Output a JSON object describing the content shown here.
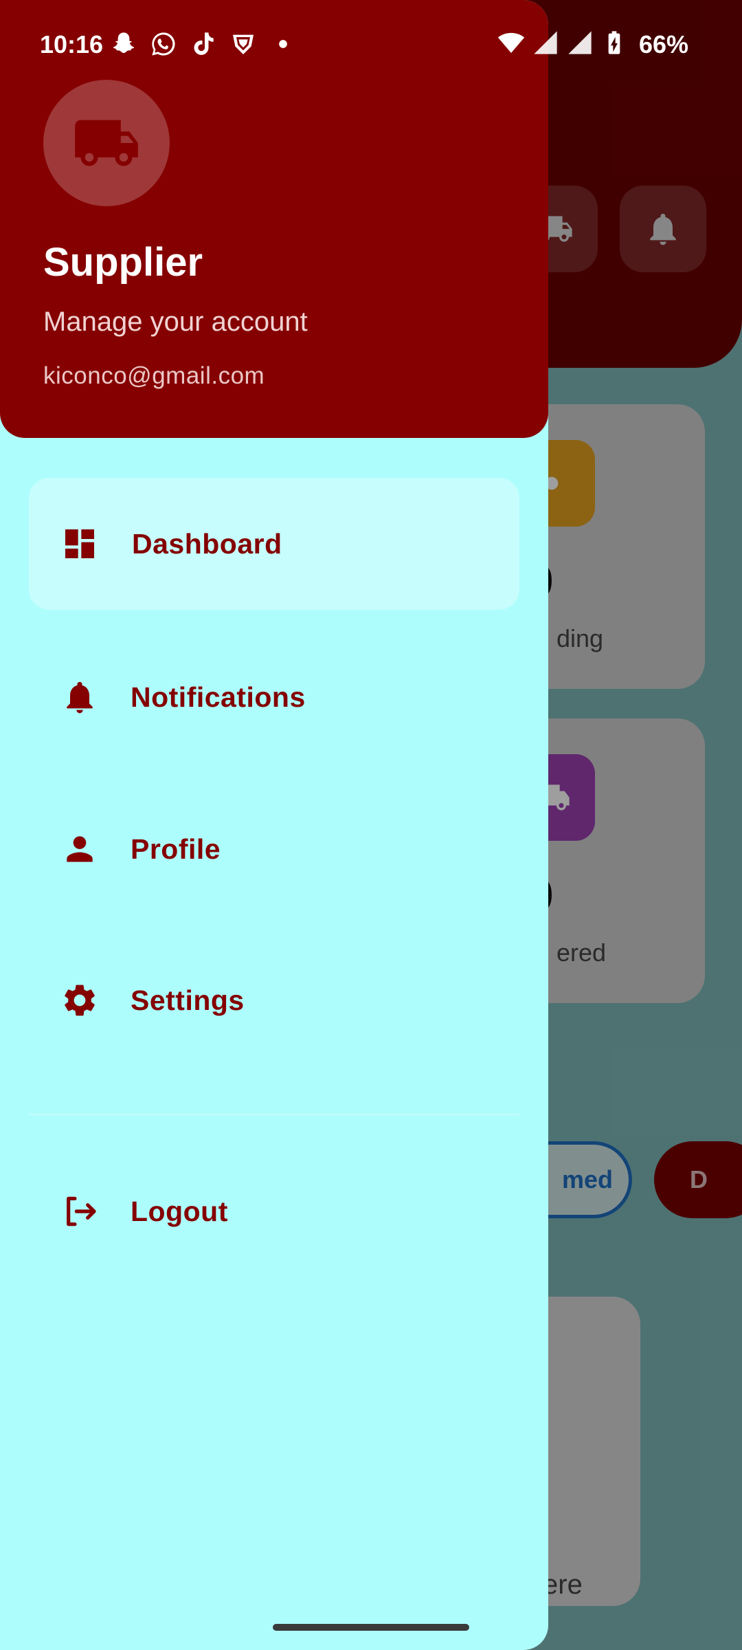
{
  "status_bar": {
    "time": "10:16",
    "battery": "66%",
    "left_icons": [
      "snapchat-icon",
      "whatsapp-icon",
      "tiktok-icon",
      "vpn-icon",
      "dot-icon"
    ],
    "right_icons": [
      "wifi-icon",
      "signal-icon",
      "signal-icon",
      "battery-icon"
    ]
  },
  "drawer": {
    "header": {
      "avatar_icon": "truck-icon",
      "title": "Supplier",
      "subtitle": "Manage your account",
      "email": "kiconco@gmail.com"
    },
    "items": [
      {
        "label": "Dashboard",
        "icon": "dashboard-icon",
        "active": true
      },
      {
        "label": "Notifications",
        "icon": "bell-icon",
        "active": false
      },
      {
        "label": "Profile",
        "icon": "person-icon",
        "active": false
      },
      {
        "label": "Settings",
        "icon": "gear-icon",
        "active": false
      }
    ],
    "logout": {
      "label": "Logout",
      "icon": "logout-icon"
    }
  },
  "background": {
    "cards": [
      {
        "value": "0",
        "label": "ding",
        "badge_color": "#e0a020"
      },
      {
        "value": "0",
        "label": "ered",
        "badge_color": "#9b3fb0"
      }
    ],
    "chips": [
      {
        "label": "med"
      },
      {
        "label": "D"
      }
    ],
    "list_text": "ere"
  },
  "colors": {
    "primary": "#850000",
    "drawer_bg": "#aefdfd",
    "active_item_bg": "#c7fdfd"
  }
}
